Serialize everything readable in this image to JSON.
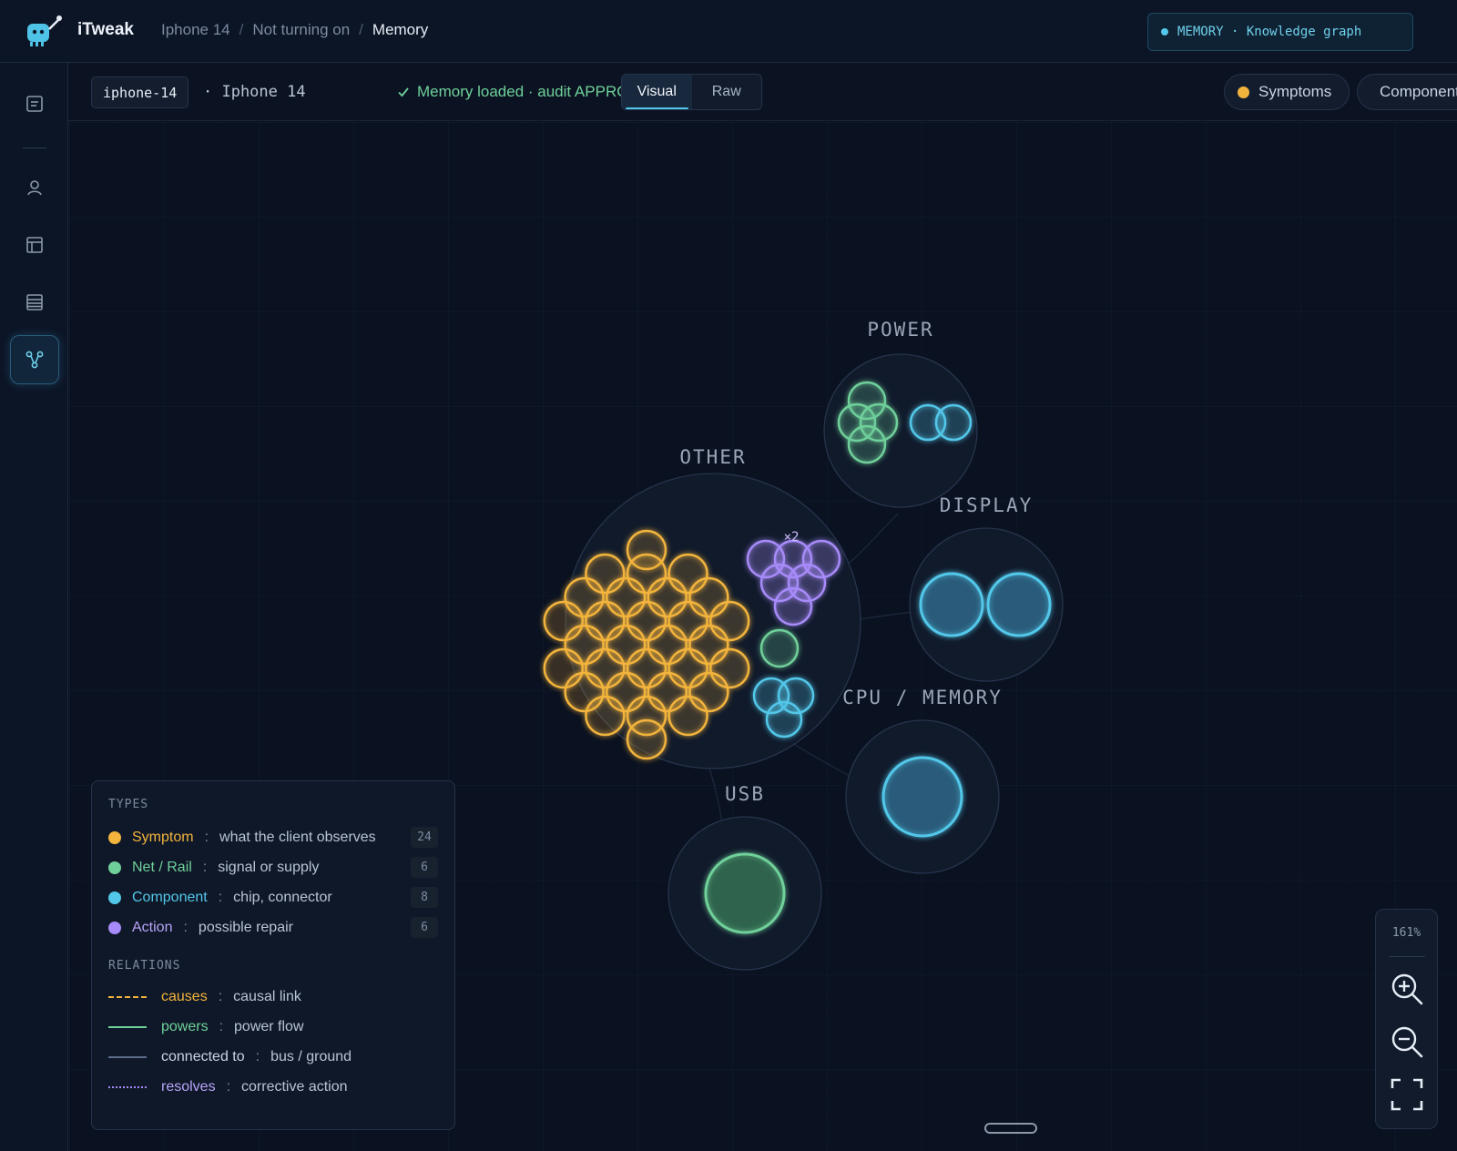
{
  "header": {
    "app_title": "iTweak",
    "breadcrumbs": [
      "Iphone 14",
      "Not turning on",
      "Memory"
    ],
    "memory_chip": "MEMORY · Knowledge graph"
  },
  "sidebar": {
    "icons": [
      "document-icon",
      "person-icon",
      "grid-icon",
      "list-icon",
      "graph-icon"
    ],
    "active": "graph-icon"
  },
  "subbar": {
    "device_id": "iphone-14",
    "device_name": "· Iphone 14",
    "status": "Memory loaded · audit APPROVED",
    "tabs": [
      "Visual",
      "Raw"
    ],
    "active_tab": "Visual",
    "filters": [
      {
        "label": "Symptoms",
        "color": "#f2b43c"
      },
      {
        "label": "Components",
        "color": "#52c7e9"
      }
    ]
  },
  "graph": {
    "clusters": [
      "POWER",
      "OTHER",
      "DISPLAY",
      "CPU / MEMORY",
      "USB"
    ],
    "badge": "×2"
  },
  "legend": {
    "types_title": "TYPES",
    "types": [
      {
        "name": "Symptom",
        "desc": "what the client observes",
        "count": "24",
        "color": "#f2b43c"
      },
      {
        "name": "Net / Rail",
        "desc": "signal or supply",
        "count": "6",
        "color": "#6fd09a"
      },
      {
        "name": "Component",
        "desc": "chip, connector",
        "count": "8",
        "color": "#52c7e9"
      },
      {
        "name": "Action",
        "desc": "possible repair",
        "count": "6",
        "color": "#a78bfa"
      }
    ],
    "relations_title": "RELATIONS",
    "relations": [
      {
        "name": "causes",
        "desc": "causal link",
        "color": "#f2b43c",
        "style": "dashed"
      },
      {
        "name": "powers",
        "desc": "power flow",
        "color": "#6fd09a",
        "style": "solid"
      },
      {
        "name": "connected to",
        "desc": "bus / ground",
        "color": "#5b6b8a",
        "style": "solid"
      },
      {
        "name": "resolves",
        "desc": "corrective action",
        "color": "#a78bfa",
        "style": "dotted"
      }
    ]
  },
  "zoom": {
    "level": "161%"
  }
}
